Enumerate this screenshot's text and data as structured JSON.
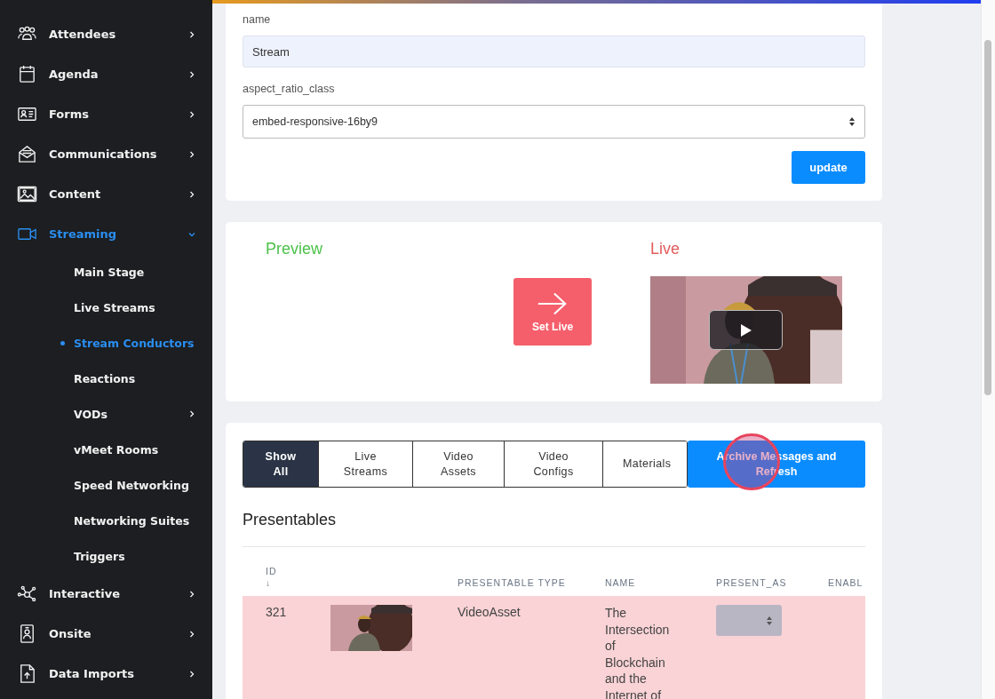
{
  "sidebar": {
    "items": [
      {
        "label": "Attendees",
        "selected": false,
        "expanded": false
      },
      {
        "label": "Agenda",
        "selected": false,
        "expanded": false
      },
      {
        "label": "Forms",
        "selected": false,
        "expanded": false
      },
      {
        "label": "Communications",
        "selected": false,
        "expanded": false
      },
      {
        "label": "Content",
        "selected": false,
        "expanded": false
      },
      {
        "label": "Streaming",
        "selected": true,
        "expanded": true,
        "children": [
          {
            "label": "Main Stage",
            "selected": false,
            "has_submenu": false
          },
          {
            "label": "Live Streams",
            "selected": false,
            "has_submenu": false
          },
          {
            "label": "Stream Conductors",
            "selected": true,
            "has_submenu": false
          },
          {
            "label": "Reactions",
            "selected": false,
            "has_submenu": false
          },
          {
            "label": "VODs",
            "selected": false,
            "has_submenu": true
          },
          {
            "label": "vMeet Rooms",
            "selected": false,
            "has_submenu": false
          },
          {
            "label": "Speed Networking",
            "selected": false,
            "has_submenu": false
          },
          {
            "label": "Networking Suites",
            "selected": false,
            "has_submenu": false
          },
          {
            "label": "Triggers",
            "selected": false,
            "has_submenu": false
          }
        ]
      },
      {
        "label": "Interactive",
        "selected": false,
        "expanded": false
      },
      {
        "label": "Onsite",
        "selected": false,
        "expanded": false
      },
      {
        "label": "Data Imports",
        "selected": false,
        "expanded": false
      }
    ]
  },
  "settings_form": {
    "name_label": "name",
    "name_value": "Stream",
    "aspect_label": "aspect_ratio_class",
    "aspect_value": "embed-responsive-16by9",
    "update_button": "update"
  },
  "preview_panel": {
    "preview_title": "Preview",
    "live_title": "Live",
    "set_live_button": "Set Live"
  },
  "filter_tabs": [
    {
      "label": "Show All",
      "selected": true
    },
    {
      "label": "Live Streams",
      "selected": false
    },
    {
      "label": "Video Assets",
      "selected": false
    },
    {
      "label": "Video Configs",
      "selected": false
    },
    {
      "label": "Materials",
      "selected": false
    }
  ],
  "archive_button": "Archive Messages and Refresh",
  "presentables": {
    "title": "Presentables",
    "columns": [
      {
        "label": "ID",
        "sort_indicator": "↓"
      },
      {
        "label": "PRESENTABLE TYPE"
      },
      {
        "label": "NAME"
      },
      {
        "label": "PRESENT_AS"
      },
      {
        "label": "ENABL"
      }
    ],
    "rows": [
      {
        "id": "321",
        "type": "VideoAsset",
        "name": "The Intersection of Blockchain and the Internet of",
        "highlighted": true
      }
    ]
  }
}
